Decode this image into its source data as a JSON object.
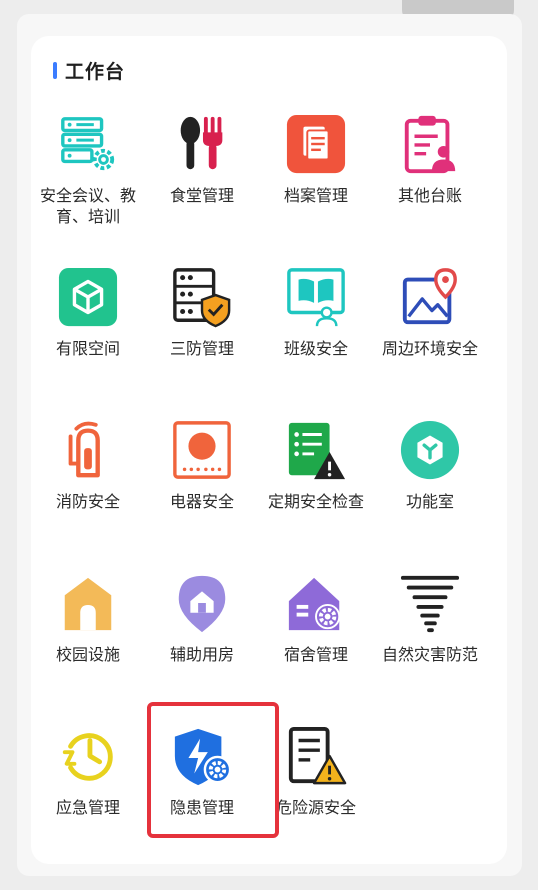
{
  "section": {
    "title": "工作台"
  },
  "tiles": [
    {
      "label": "安全会议、教育、培训",
      "icon": "server-gear-icon"
    },
    {
      "label": "食堂管理",
      "icon": "spoon-fork-icon"
    },
    {
      "label": "档案管理",
      "icon": "archive-document-icon"
    },
    {
      "label": "其他台账",
      "icon": "clipboard-user-icon"
    },
    {
      "label": "有限空间",
      "icon": "cube-icon"
    },
    {
      "label": "三防管理",
      "icon": "server-shield-icon"
    },
    {
      "label": "班级安全",
      "icon": "book-group-icon"
    },
    {
      "label": "周边环境安全",
      "icon": "map-pin-icon"
    },
    {
      "label": "消防安全",
      "icon": "fire-extinguisher-icon"
    },
    {
      "label": "电器安全",
      "icon": "appliance-icon"
    },
    {
      "label": "定期安全检查",
      "icon": "checklist-warning-icon"
    },
    {
      "label": "功能室",
      "icon": "hexagon-room-icon"
    },
    {
      "label": "校园设施",
      "icon": "building-icon"
    },
    {
      "label": "辅助用房",
      "icon": "house-pin-icon"
    },
    {
      "label": "宿舍管理",
      "icon": "house-gear-icon"
    },
    {
      "label": "自然灾害防范",
      "icon": "tornado-icon"
    },
    {
      "label": "应急管理",
      "icon": "emergency-clock-icon"
    },
    {
      "label": "隐患管理",
      "icon": "shield-bolt-gear-icon"
    },
    {
      "label": "危险源安全",
      "icon": "document-warning-icon"
    }
  ],
  "colors": {
    "accent": "#3b7cff",
    "highlight": "#e5323c",
    "teal": "#1ec6c0",
    "orange": "#f0643c",
    "pink": "#e0307a"
  }
}
